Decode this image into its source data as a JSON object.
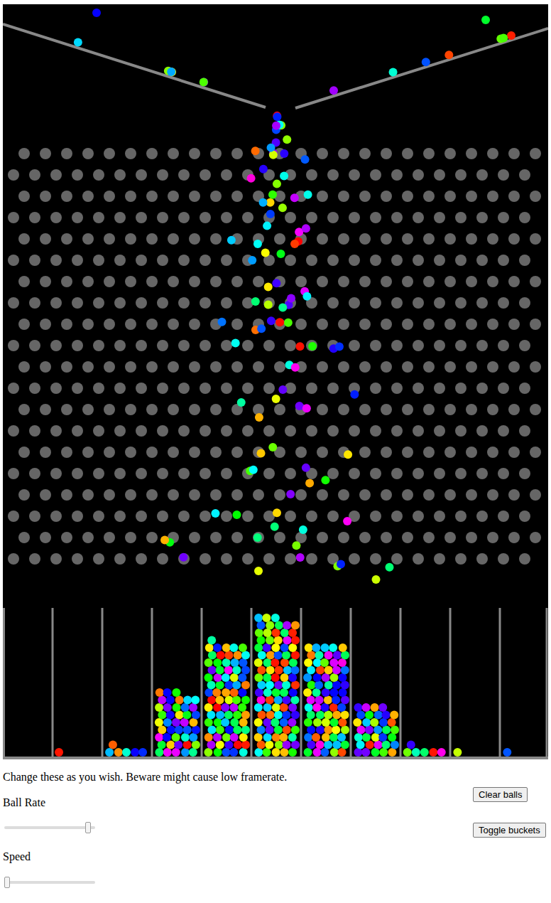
{
  "instructions": "Change these as you wish. Beware might cause low framerate.",
  "sliders": [
    {
      "label": "Ball Rate",
      "level": 0.95
    },
    {
      "label": "Speed",
      "level": 0
    }
  ],
  "buttons": [
    {
      "label": "Clear balls"
    },
    {
      "label": "Toggle buckets"
    }
  ],
  "buckets_shown": true,
  "buckets": [
    {
      "level": 0
    },
    {
      "level": 0.01
    },
    {
      "level": 0.06
    },
    {
      "level": 0.43
    },
    {
      "level": 0.76
    },
    {
      "level": 0.93
    },
    {
      "level": 0.75
    },
    {
      "level": 0.34
    },
    {
      "level": 0.06
    },
    {
      "level": 0.01
    },
    {
      "level": 0.01
    }
  ]
}
